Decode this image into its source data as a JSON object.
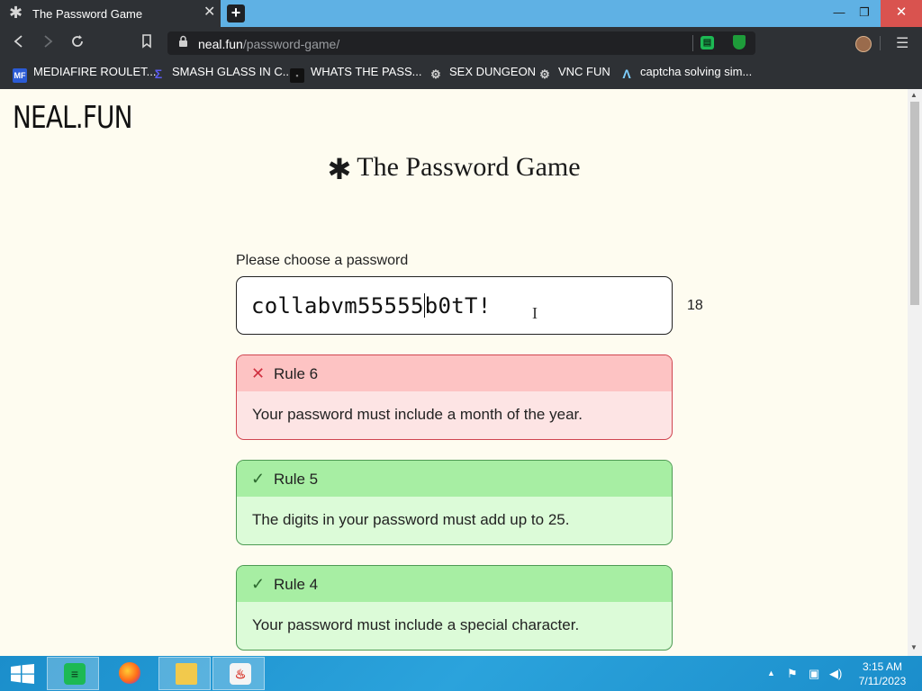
{
  "browser": {
    "tab_title": "The Password Game",
    "tab_favicon": "✱",
    "tab_close": "✕",
    "new_tab": "+",
    "window_minimize": "—",
    "window_restore": "❐",
    "window_close": "✕",
    "url_domain": "neal.fun",
    "url_path": "/password-game/",
    "menu_icon": "☰",
    "extension_1": "▤"
  },
  "bookmarks": [
    {
      "label": "MEDIAFIRE ROULET...",
      "icon": "MF",
      "color": "#2b5bd6"
    },
    {
      "label": "SMASH GLASS IN C...",
      "icon": "Σ",
      "color": "#3b3bd0"
    },
    {
      "label": "WHATS THE PASS...",
      "icon": "▪",
      "color": "#111111"
    },
    {
      "label": "SEX DUNGEON",
      "icon": "⚙",
      "color": "#666666"
    },
    {
      "label": "VNC FUN",
      "icon": "⚙",
      "color": "#666666"
    },
    {
      "label": "captcha solving sim...",
      "icon": "Λ",
      "color": "#2a6fdb"
    }
  ],
  "page": {
    "logo": "NEAL.FUN",
    "heading_star": "✱",
    "heading": "The Password Game",
    "prompt": "Please choose a password",
    "password_before_caret": "collabvm55555",
    "password_after_caret": "b0tT!",
    "char_count": "18",
    "text_cursor": "I"
  },
  "rules": [
    {
      "status": "fail",
      "icon": "✕",
      "title": "Rule 6",
      "text": "Your password must include a month of the year."
    },
    {
      "status": "pass",
      "icon": "✓",
      "title": "Rule 5",
      "text": "The digits in your password must add up to 25."
    },
    {
      "status": "pass",
      "icon": "✓",
      "title": "Rule 4",
      "text": "Your password must include a special character."
    }
  ],
  "taskbar": {
    "apps": [
      "spotify-icon",
      "firefox-icon",
      "file-explorer-icon",
      "java-icon"
    ],
    "time": "3:15 AM",
    "date": "7/11/2023"
  },
  "colors": {
    "page_bg": "#fefcf0",
    "fail_border": "#d04550",
    "pass_border": "#4d9b53",
    "taskbar": "#1b8ecb"
  }
}
